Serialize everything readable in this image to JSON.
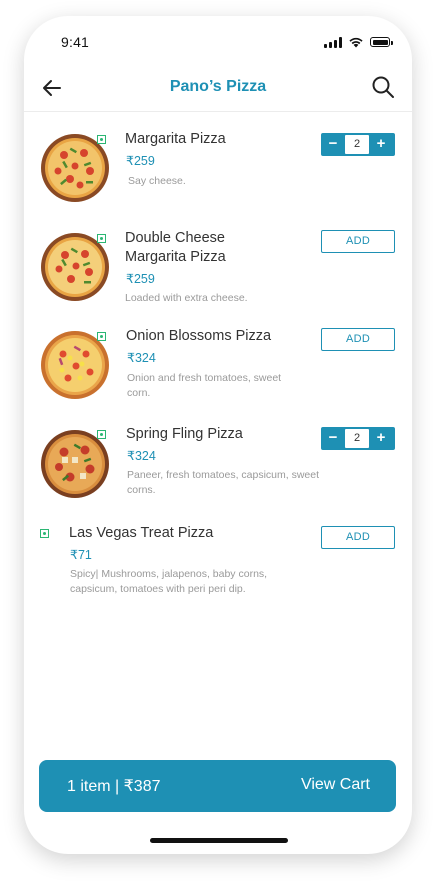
{
  "status_bar": {
    "time": "9:41"
  },
  "header": {
    "title": "Pano’s Pizza"
  },
  "items": [
    {
      "name": "Margarita Pizza",
      "price": "₹259",
      "description": "Say cheese.",
      "action": "stepper",
      "quantity": "2"
    },
    {
      "name": "Double Cheese Margarita Pizza",
      "price": "₹259",
      "description": "Loaded with extra cheese.",
      "action": "add",
      "add_label": "ADD"
    },
    {
      "name": "Onion Blossoms Pizza",
      "price": "₹324",
      "description": "Onion and fresh tomatoes, sweet corn.",
      "action": "add",
      "add_label": "ADD"
    },
    {
      "name": "Spring Fling Pizza",
      "price": "₹324",
      "description": "Paneer, fresh tomatoes, capsicum, sweet corns.",
      "action": "stepper",
      "quantity": "2"
    },
    {
      "name": "Las Vegas Treat Pizza",
      "price": "₹71",
      "description": "Spicy| Mushrooms, jalapenos, baby corns, capsicum, tomatoes with peri peri dip.",
      "action": "add",
      "add_label": "ADD"
    }
  ],
  "stepper": {
    "minus": "−",
    "plus": "+"
  },
  "cart": {
    "summary": "1 item | ₹387",
    "action_label": "View Cart"
  },
  "colors": {
    "accent": "#1e90b4",
    "veg": "#2bb673"
  }
}
